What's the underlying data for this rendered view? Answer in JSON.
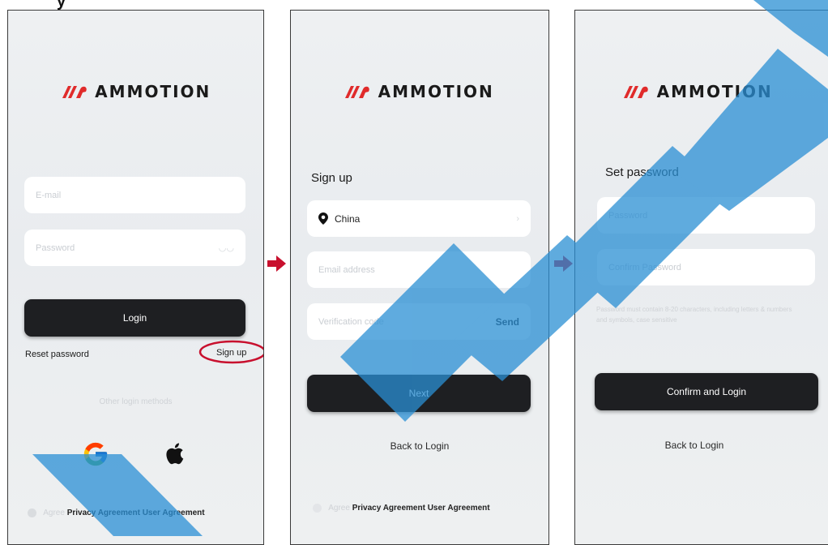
{
  "heading": "y",
  "brand": {
    "name": "AMMOTION"
  },
  "login_screen": {
    "email_placeholder": "E-mail",
    "password_placeholder": "Password",
    "login_button": "Login",
    "reset_password": "Reset password",
    "sign_up": "Sign up",
    "other_methods": "Other login methods",
    "agree_prefix": "Agree",
    "agree_links": "Privacy Agreement User Agreement"
  },
  "signup_screen": {
    "title": "Sign up",
    "country": "China",
    "email_placeholder": "Email address",
    "code_placeholder": "Verification code",
    "send": "Send",
    "next_button": "Next",
    "back_link": "Back to Login",
    "agree_prefix": "Agree",
    "agree_links": "Privacy Agreement User Agreement"
  },
  "password_screen": {
    "title": "Set password",
    "password_placeholder": "Password",
    "confirm_placeholder": "Confirm Password",
    "hint_line1": "Password must contain 8-20 characters, including letters & numbers",
    "hint_line2": "and symbols, case sensitive",
    "confirm_button": "Confirm and Login",
    "back_link": "Back to Login"
  },
  "colors": {
    "brand_red": "#e02b2b",
    "arrow_red": "#c8102e",
    "button_dark": "#1e1f22",
    "highlight": "#c8102e",
    "watermark": "#2a8fd4"
  }
}
